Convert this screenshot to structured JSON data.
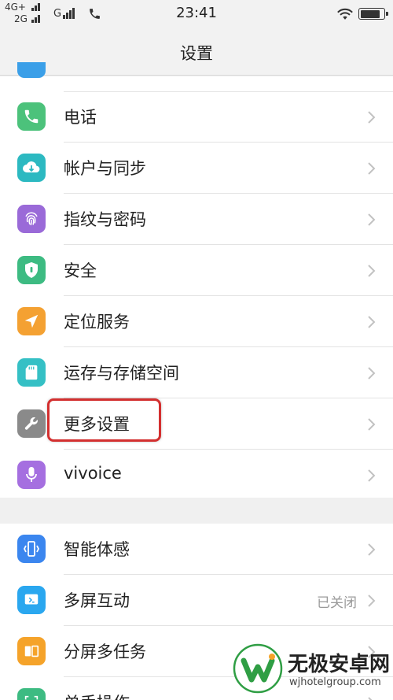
{
  "status_bar": {
    "sim1_top": "4G+",
    "sim1_bottom": "2G",
    "sim2": "G",
    "time": "23:41",
    "icons": [
      "signal-icon",
      "signal-icon",
      "signal-icon",
      "phone-icon",
      "wifi-icon",
      "battery-icon"
    ],
    "battery_level": 0.9
  },
  "header": {
    "title": "设置"
  },
  "colors": {
    "phone": "#4cc27b",
    "account": "#2cb9c1",
    "fingerprint": "#9a6ad8",
    "security": "#3dbb82",
    "location": "#f4a132",
    "storage": "#35c0c5",
    "more": "#8a8a8a",
    "vivoice": "#a56fe0",
    "smart": "#3b86ef",
    "multiscreen": "#2aa7ef",
    "splitscreen": "#f5a32a",
    "highlight": "#d32f2f"
  },
  "settings_group_1": [
    {
      "label": "电话",
      "icon": "phone-icon"
    },
    {
      "label": "帐户与同步",
      "icon": "cloud-sync-icon"
    },
    {
      "label": "指纹与密码",
      "icon": "fingerprint-icon"
    },
    {
      "label": "安全",
      "icon": "shield-icon"
    },
    {
      "label": "定位服务",
      "icon": "location-arrow-icon"
    },
    {
      "label": "运存与存储空间",
      "icon": "sd-card-icon"
    },
    {
      "label": "更多设置",
      "icon": "wrench-icon"
    },
    {
      "label": "vivoice",
      "icon": "microphone-icon"
    }
  ],
  "settings_group_2": [
    {
      "label": "智能体感",
      "icon": "phone-motion-icon"
    },
    {
      "label": "多屏互动",
      "icon": "cast-screen-icon",
      "value": "已关闭"
    },
    {
      "label": "分屏多任务",
      "icon": "split-screen-icon"
    },
    {
      "label": "单手操作",
      "icon": "one-hand-icon"
    }
  ],
  "watermark": {
    "name": "无极安卓网",
    "url": "wjhotelgroup.com"
  }
}
